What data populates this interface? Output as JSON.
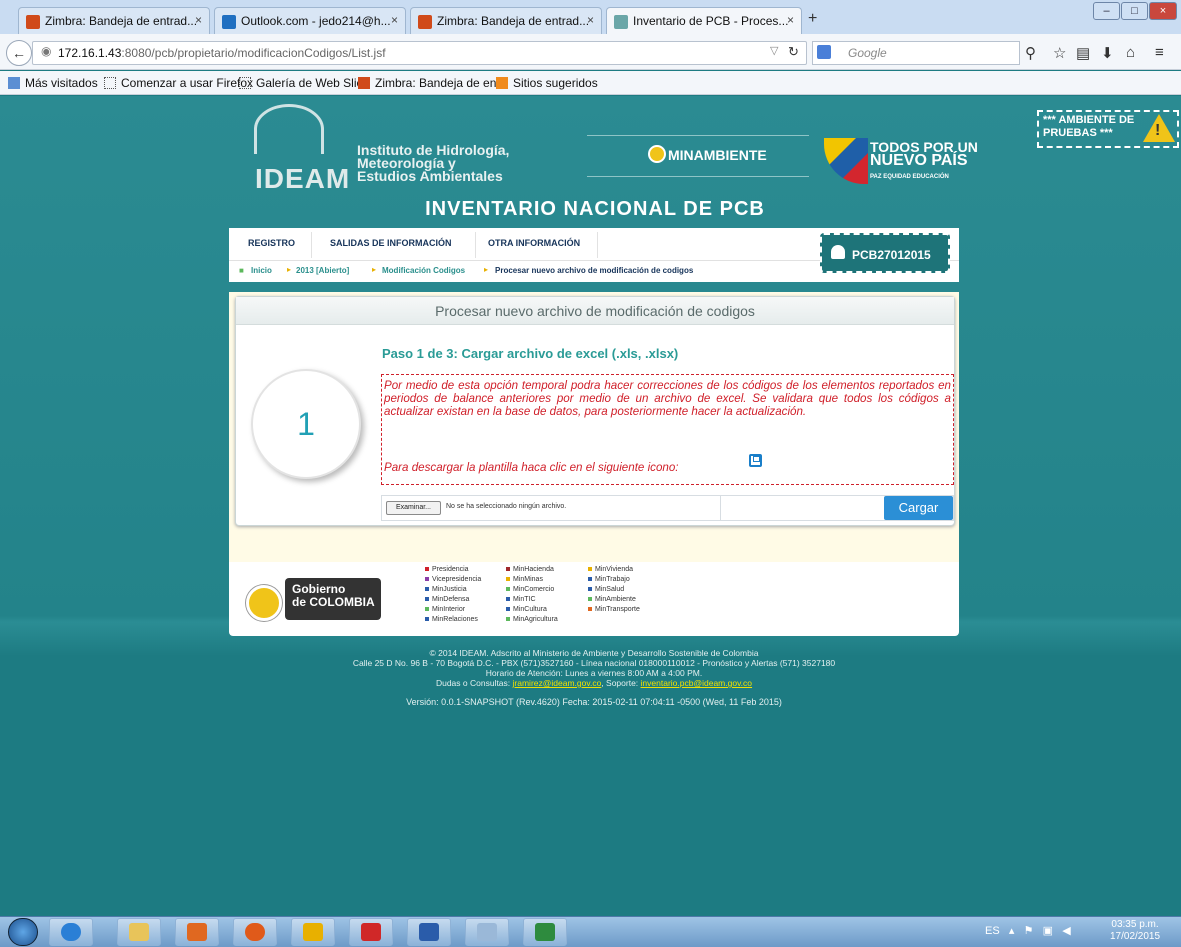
{
  "browser": {
    "tabs": [
      {
        "label": "Zimbra: Bandeja de entrad...",
        "close": "×"
      },
      {
        "label": "Outlook.com - jedo214@h...",
        "close": "×"
      },
      {
        "label": "Zimbra: Bandeja de entrad...",
        "close": "×"
      },
      {
        "label": "Inventario de PCB - Proces...",
        "close": "×"
      }
    ],
    "new_tab": "+",
    "url_host": "172.16.1.43",
    "url_rest": ":8080/pcb/propietario/modificacionCodigos/List.jsf",
    "search_placeholder": "Google",
    "bookmarks": [
      "Más visitados",
      "Comenzar a usar Firefox",
      "Galería de Web Slice",
      "Zimbra: Bandeja de en...",
      "Sitios sugeridos"
    ],
    "window_buttons": [
      "–",
      "□",
      "×"
    ]
  },
  "header": {
    "ambiente": "*** AMBIENTE DE PRUEBAS ***",
    "warning_mark": "!",
    "ideam": "IDEAM",
    "institute": [
      "Instituto de Hidrología,",
      "Meteorología y",
      "Estudios Ambientales"
    ],
    "minambiente": "MINAMBIENTE",
    "todos": [
      "TODOS POR UN",
      "NUEVO PAÍS"
    ],
    "todos_sub": "PAZ  EQUIDAD  EDUCACIÓN",
    "site_title": "INVENTARIO NACIONAL DE PCB",
    "menu": [
      "REGISTRO",
      "SALIDAS DE INFORMACIÓN",
      "OTRA INFORMACIÓN"
    ],
    "user": "PCB27012015"
  },
  "breadcrumb": [
    "Inicio",
    "2013 [Abierto]",
    "Modificación Codigos",
    "Procesar nuevo archivo de modificación de codigos"
  ],
  "panel": {
    "title": "Procesar nuevo archivo de modificación de codigos",
    "step_number": "1",
    "step_title": "Paso 1 de 3: Cargar archivo de excel (.xls, .xlsx)",
    "info": "Por medio de esta opción temporal podra hacer correcciones de los códigos de los elementos reportados en periodos de balance anteriores por medio de un archivo de excel. Se validara que todos los códigos a actualizar existan en la base de datos, para posteriormente hacer la actualización.",
    "download_text": "Para descargar la plantilla haca clic en el siguiente icono:",
    "browse_label": "Examinar...",
    "no_file": "No se ha seleccionado ningún archivo.",
    "upload_label": "Cargar"
  },
  "footer": {
    "gobierno": [
      "Gobierno",
      "de COLOMBIA"
    ],
    "links_col1": [
      "Presidencia",
      "Vicepresidencia",
      "MinJusticia",
      "MinDefensa",
      "MinInterior",
      "MinRelaciones"
    ],
    "links_col2": [
      "MinHacienda",
      "MinMinas",
      "MinComercio",
      "MinTIC",
      "MinCultura",
      "MinAgricultura"
    ],
    "links_col3": [
      "MinVivienda",
      "MinTrabajo",
      "MinSalud",
      "MinAmbiente",
      "MinTransporte"
    ],
    "copyright": "© 2014 IDEAM. Adscrito al Ministerio de Ambiente y Desarrollo Sostenible de Colombia",
    "address": "Calle 25 D No. 96 B - 70 Bogotá D.C. - PBX (571)3527160 - Línea nacional 018000110012 - Pronóstico y Alertas (571) 3527180",
    "hours": "Horario de Atención: Lunes a viernes 8:00 AM a 4:00 PM.",
    "dudas_label": "Dudas o Consultas:",
    "dudas_email": "jramirez@ideam.gov.co",
    "soporte_label": ", Soporte:",
    "soporte_email": "inventario.pcb@ideam.gov.co",
    "version": "Versión: 0.0.1-SNAPSHOT (Rev.4620) Fecha: 2015-02-11 07:04:11 -0500 (Wed, 11 Feb 2015)"
  },
  "taskbar": {
    "lang": "ES",
    "time": "03:35 p.m.",
    "date": "17/02/2015"
  },
  "colors": {
    "page_bg": "#23838a",
    "accent": "#2b8fd6",
    "error": "#d0202a",
    "step": "#21a0b5"
  }
}
